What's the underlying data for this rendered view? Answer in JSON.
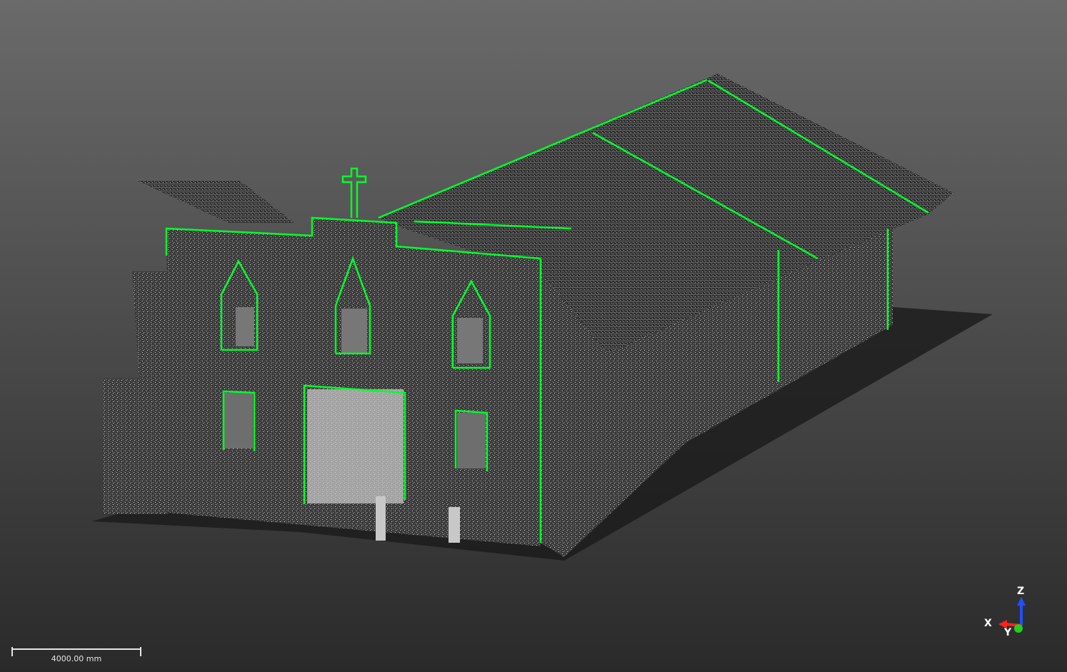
{
  "viewer": {
    "background_top": "#6a6a6a",
    "background_bottom": "#2a2a2a",
    "edge_color": "#00ff2a",
    "point_cloud_color": "#b8b8b8"
  },
  "scale_bar": {
    "label": "4000.00 mm"
  },
  "axis_triad": {
    "z_label": "Z",
    "x_label": "X",
    "y_label": "Y",
    "z_color": "#2050ff",
    "x_color": "#ff2020",
    "y_color": "#20d020"
  }
}
